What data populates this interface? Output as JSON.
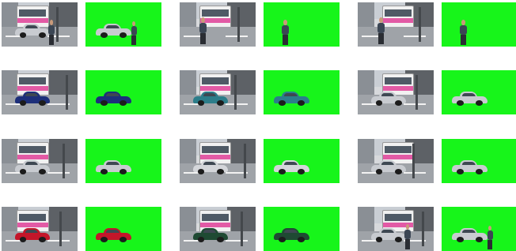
{
  "colors": {
    "mask_background": "#17f51a",
    "page_background": "#ffffff"
  },
  "pairs": [
    {
      "row": 1,
      "col": 1,
      "subject": "car",
      "car_color": "#c8cbd0",
      "has_person": true
    },
    {
      "row": 1,
      "col": 2,
      "subject": "person",
      "car_color": null,
      "has_person": true
    },
    {
      "row": 1,
      "col": 3,
      "subject": "person",
      "car_color": null,
      "has_person": true
    },
    {
      "row": 2,
      "col": 1,
      "subject": "car",
      "car_color": "#1d2f7a",
      "has_person": false
    },
    {
      "row": 2,
      "col": 2,
      "subject": "car",
      "car_color": "#2c7d8a",
      "has_person": false
    },
    {
      "row": 2,
      "col": 3,
      "subject": "car",
      "car_color": "#c8cbd0",
      "has_person": false
    },
    {
      "row": 3,
      "col": 1,
      "subject": "car",
      "car_color": "#c8cbd0",
      "has_person": false
    },
    {
      "row": 3,
      "col": 2,
      "subject": "car",
      "car_color": "#d4d6da",
      "has_person": false
    },
    {
      "row": 3,
      "col": 3,
      "subject": "car",
      "car_color": "#c8cbd0",
      "has_person": false
    },
    {
      "row": 4,
      "col": 1,
      "subject": "car",
      "car_color": "#c4162a",
      "has_person": false
    },
    {
      "row": 4,
      "col": 2,
      "subject": "car",
      "car_color": "#1f4a33",
      "has_person": false
    },
    {
      "row": 4,
      "col": 3,
      "subject": "car",
      "car_color": "#c8cbd0",
      "has_person": true
    }
  ]
}
